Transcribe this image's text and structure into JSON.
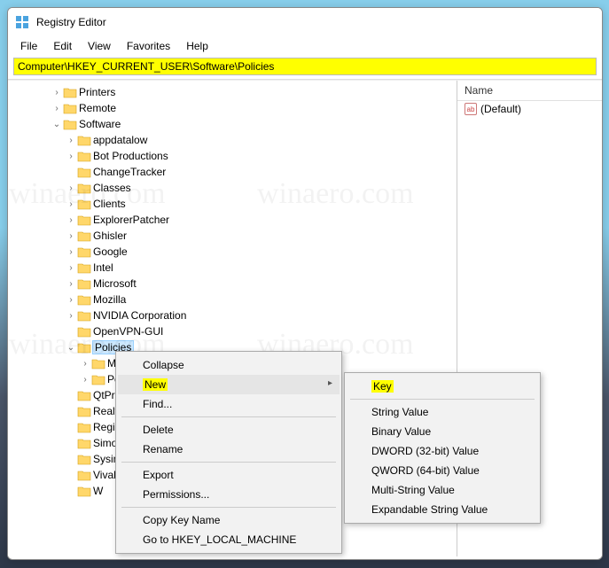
{
  "window": {
    "title": "Registry Editor"
  },
  "menubar": {
    "file": "File",
    "edit": "Edit",
    "view": "View",
    "favorites": "Favorites",
    "help": "Help"
  },
  "addressbar": {
    "value": "Computer\\HKEY_CURRENT_USER\\Software\\Policies"
  },
  "tree": {
    "items": [
      {
        "label": "Printers",
        "indent": 1,
        "expandable": true,
        "expanded": false
      },
      {
        "label": "Remote",
        "indent": 1,
        "expandable": true,
        "expanded": false
      },
      {
        "label": "Software",
        "indent": 1,
        "expandable": true,
        "expanded": true
      },
      {
        "label": "appdatalow",
        "indent": 2,
        "expandable": true,
        "expanded": false
      },
      {
        "label": "Bot Productions",
        "indent": 2,
        "expandable": true,
        "expanded": false
      },
      {
        "label": "ChangeTracker",
        "indent": 2,
        "expandable": false,
        "expanded": false
      },
      {
        "label": "Classes",
        "indent": 2,
        "expandable": true,
        "expanded": false
      },
      {
        "label": "Clients",
        "indent": 2,
        "expandable": true,
        "expanded": false
      },
      {
        "label": "ExplorerPatcher",
        "indent": 2,
        "expandable": true,
        "expanded": false
      },
      {
        "label": "Ghisler",
        "indent": 2,
        "expandable": true,
        "expanded": false
      },
      {
        "label": "Google",
        "indent": 2,
        "expandable": true,
        "expanded": false
      },
      {
        "label": "Intel",
        "indent": 2,
        "expandable": true,
        "expanded": false
      },
      {
        "label": "Microsoft",
        "indent": 2,
        "expandable": true,
        "expanded": false
      },
      {
        "label": "Mozilla",
        "indent": 2,
        "expandable": true,
        "expanded": false
      },
      {
        "label": "NVIDIA Corporation",
        "indent": 2,
        "expandable": true,
        "expanded": false
      },
      {
        "label": "OpenVPN-GUI",
        "indent": 2,
        "expandable": false,
        "expanded": false
      },
      {
        "label": "Policies",
        "indent": 2,
        "expandable": true,
        "expanded": true,
        "selected": true
      },
      {
        "label": "M",
        "indent": 3,
        "expandable": true,
        "expanded": false
      },
      {
        "label": "Po",
        "indent": 3,
        "expandable": true,
        "expanded": false
      },
      {
        "label": "QtPr",
        "indent": 2,
        "expandable": false,
        "expanded": false
      },
      {
        "label": "Realt",
        "indent": 2,
        "expandable": false,
        "expanded": false
      },
      {
        "label": "Regis",
        "indent": 2,
        "expandable": false,
        "expanded": false
      },
      {
        "label": "Simo",
        "indent": 2,
        "expandable": false,
        "expanded": false
      },
      {
        "label": "Sysin",
        "indent": 2,
        "expandable": false,
        "expanded": false
      },
      {
        "label": "Vival",
        "indent": 2,
        "expandable": false,
        "expanded": false
      },
      {
        "label": "W",
        "indent": 2,
        "expandable": false,
        "expanded": false
      }
    ]
  },
  "values_pane": {
    "header_name": "Name",
    "default_value_label": "(Default)"
  },
  "context_menu_1": {
    "collapse": "Collapse",
    "new": "New",
    "find": "Find...",
    "delete": "Delete",
    "rename": "Rename",
    "export": "Export",
    "permissions": "Permissions...",
    "copy_key_name": "Copy Key Name",
    "goto_hklm": "Go to HKEY_LOCAL_MACHINE"
  },
  "context_menu_2": {
    "key": "Key",
    "string_value": "String Value",
    "binary_value": "Binary Value",
    "dword_value": "DWORD (32-bit) Value",
    "qword_value": "QWORD (64-bit) Value",
    "multi_string_value": "Multi-String Value",
    "expandable_string_value": "Expandable String Value"
  },
  "watermark": "winaero.com"
}
